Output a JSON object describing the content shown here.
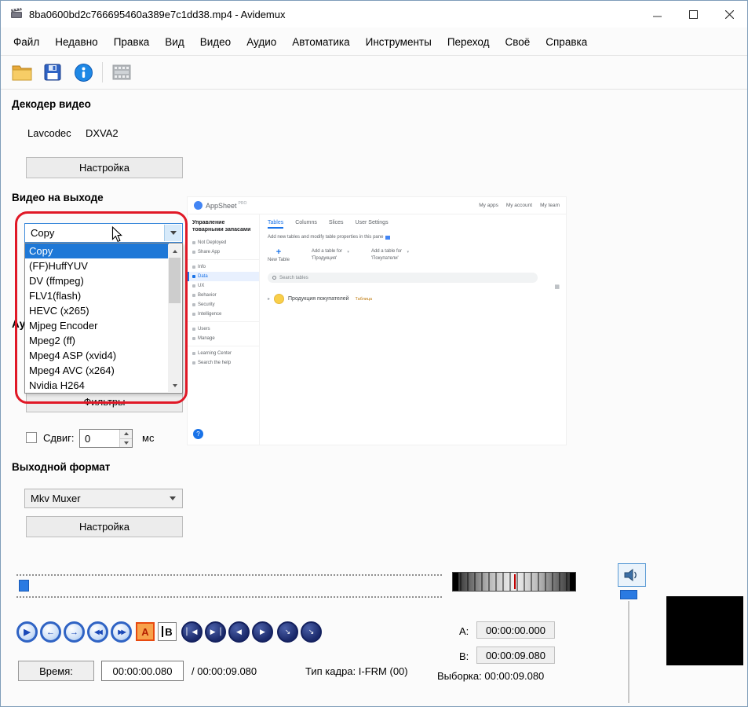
{
  "window": {
    "title": "8ba0600bd2c766695460a389e7c1dd38.mp4 - Avidemux"
  },
  "menu": {
    "items": [
      "Файл",
      "Недавно",
      "Правка",
      "Вид",
      "Видео",
      "Аудио",
      "Автоматика",
      "Инструменты",
      "Переход",
      "Своё",
      "Справка"
    ]
  },
  "decoder": {
    "header": "Декодер видео",
    "engine": "Lavcodec",
    "accel": "DXVA2",
    "configure_label": "Настройка"
  },
  "video_output": {
    "header": "Видео на выходе",
    "selected": "Copy",
    "options": [
      "Copy",
      "(FF)HuffYUV",
      "DV (ffmpeg)",
      "FLV1(flash)",
      "HEVC (x265)",
      "Mjpeg Encoder",
      "Mpeg2 (ff)",
      "Mpeg4 ASP (xvid4)",
      "Mpeg4 AVC (x264)",
      "Nvidia H264"
    ]
  },
  "audio_output": {
    "header": "Аудио на выходе",
    "filters_label": "Фильтры",
    "shift_label": "Сдвиг:",
    "shift_value": "0",
    "shift_unit": "мс"
  },
  "output_format": {
    "header": "Выходной формат",
    "selected": "Mkv Muxer",
    "configure_label": "Настройка"
  },
  "preview": {
    "app_name": "AppSheet",
    "app_badge": "PRO",
    "topbar_links": [
      "My apps",
      "My account",
      "My team"
    ],
    "sidebar": {
      "app_title": "Управление товарными запасами",
      "items": [
        "Not Deployed",
        "Share App",
        "Info",
        "Data",
        "UX",
        "Behavior",
        "Security",
        "Intelligence",
        "Users",
        "Manage",
        "Learning Center",
        "Search the help"
      ]
    },
    "tabs": [
      "Tables",
      "Columns",
      "Slices",
      "User Settings"
    ],
    "caption": "Add new tables and modify table properties in this pane",
    "new_table_label": "New Table",
    "plus": "+",
    "cards": [
      {
        "line1": "Add a table for",
        "line2": "'Продукция'"
      },
      {
        "line1": "Add a table for",
        "line2": "'Покупатели'"
      }
    ],
    "search_placeholder": "Search tables",
    "table_name": "Продукция покупателей",
    "table_sub": "Таблица",
    "help_glyph": "?",
    "caret": "▾",
    "chevron": "▸",
    "grid_icon": "▦"
  },
  "transport": {
    "blue": [
      {
        "name": "play",
        "glyph": "▶"
      },
      {
        "name": "prev-frame",
        "glyph": "←"
      },
      {
        "name": "next-frame",
        "glyph": "→"
      },
      {
        "name": "prev-keyframe",
        "glyph": "◀◀"
      },
      {
        "name": "next-keyframe",
        "glyph": "▶▶"
      }
    ],
    "marker_a": "A",
    "marker_b": "B",
    "dark": [
      {
        "name": "first-frame",
        "glyph": "▏◀"
      },
      {
        "name": "last-frame",
        "glyph": "▶▕"
      },
      {
        "name": "prev-black-frame",
        "glyph": "◀"
      },
      {
        "name": "next-black-frame",
        "glyph": "▶"
      },
      {
        "name": "goto-marker-a",
        "glyph": "↘"
      },
      {
        "name": "goto-marker-b",
        "glyph": "↘"
      }
    ]
  },
  "markers": {
    "a_label": "A:",
    "a_value": "00:00:00.000",
    "b_label": "B:",
    "b_value": "00:00:09.080",
    "selection_label": "Выборка:",
    "selection_value": "00:00:09.080"
  },
  "timebar": {
    "time_button": "Время:",
    "current": "00:00:00.080",
    "total": "/ 00:00:09.080",
    "frame_label": "Тип кадра:",
    "frame_value": "I-FRM (00)"
  }
}
